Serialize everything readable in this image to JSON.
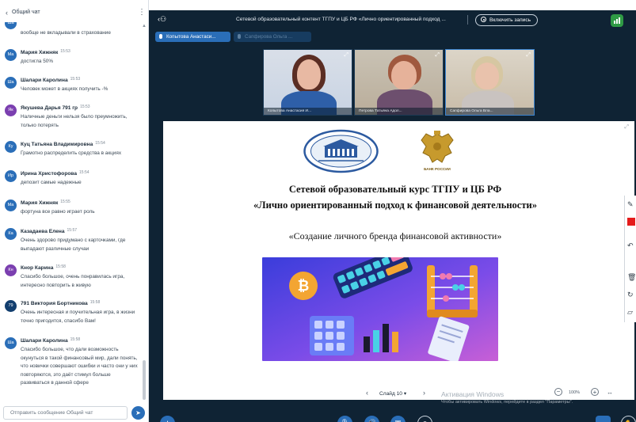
{
  "chat": {
    "back_icon": "chevron-left-icon",
    "title": "Общий чат",
    "more_icon": "kebab-icon",
    "messages": [
      {
        "initials": "",
        "name": "",
        "time": "",
        "text": "вообще не вкладывали в страхование"
      },
      {
        "initials": "Ма",
        "name": "Мария Хижняк",
        "time": "15:53",
        "text": "достигла 50%"
      },
      {
        "initials": "Ша",
        "name": "Шалари Каролина",
        "time": "15:53",
        "text": "Человек может в акциях получить -%"
      },
      {
        "initials": "Як",
        "name": "Якушева Дарья 791 гр",
        "time": "15:53",
        "text": "Наличные деньги нельзя было преумножить, только потерять"
      },
      {
        "initials": "Ку",
        "name": "Куц Татьяна Владимировна",
        "time": "15:54",
        "text": "Грамотно распределить средства в акциях"
      },
      {
        "initials": "Ир",
        "name": "Ирина Христофорова",
        "time": "15:54",
        "text": "депозит самые надежные"
      },
      {
        "initials": "Ма",
        "name": "Мария Хижняк",
        "time": "15:55",
        "text": "фортуна все равно играет роль"
      },
      {
        "initials": "Ка",
        "name": "Казадаева Елена",
        "time": "15:57",
        "text": "Очень здорово придумано с карточками, где выпадают различные случаи"
      },
      {
        "initials": "Кн",
        "name": "Кнор Карина",
        "time": "15:58",
        "text": "Спасибо большое, очень понравилась игра, интересно повторить в живую"
      },
      {
        "initials": "79",
        "name": "791 Виктория Бортникова",
        "time": "15:58",
        "text": "Очень интересная и поучительная игра, в жизни точно пригодится, спасибо Вам!"
      },
      {
        "initials": "Ша",
        "name": "Шалари Каролина",
        "time": "15:58",
        "text": "Спасибо большое, что дали возможность окунуться в такой финансовый мир, дали понять, что новички совершают ошибки и часто они у них повторяются, это даёт стимул больше развиваться в данной сфере"
      }
    ],
    "input_placeholder": "Отправить сообщение Общий чат",
    "send_icon": "send-icon"
  },
  "conference": {
    "users_icon": "users-icon",
    "meeting_title": "Сетевой образовательный контент ТГПУ и ЦБ РФ «Лично ориентированный подход ...",
    "record_label": "Включить запись",
    "stats_icon": "connection-stats-icon",
    "presenters": [
      "Копытова Анастаси...",
      "Сапфирова Ольга ..."
    ],
    "videos": [
      {
        "name": "Копытова Анастасия И... "
      },
      {
        "name": "Петрова Татьяна Адол... "
      },
      {
        "name": "Сапфирова Ольга Вла... "
      }
    ]
  },
  "slide": {
    "logo1": "ТГПУ logo",
    "logo2_text": "БАНК РОССИИ",
    "title_line1": "Сетевой образовательный курс ТГПУ и ЦБ РФ",
    "title_line2": "«Лично ориентированный подход к финансовой деятельности»",
    "subtitle": "«Создание личного бренда финансовой активности»"
  },
  "slide_nav": {
    "label": "Слайд 10",
    "zoom": "100%",
    "watermark_line1": "Активация Windows",
    "watermark_line2": "Чтобы активировать Windows, перейдите в раздел \"Параметры\"."
  },
  "colors": {
    "chat_accent": "#2a6eb8",
    "conference_bg": "#0f2334",
    "record_red": "#e51b1b",
    "stats_green": "#2f9a45"
  }
}
